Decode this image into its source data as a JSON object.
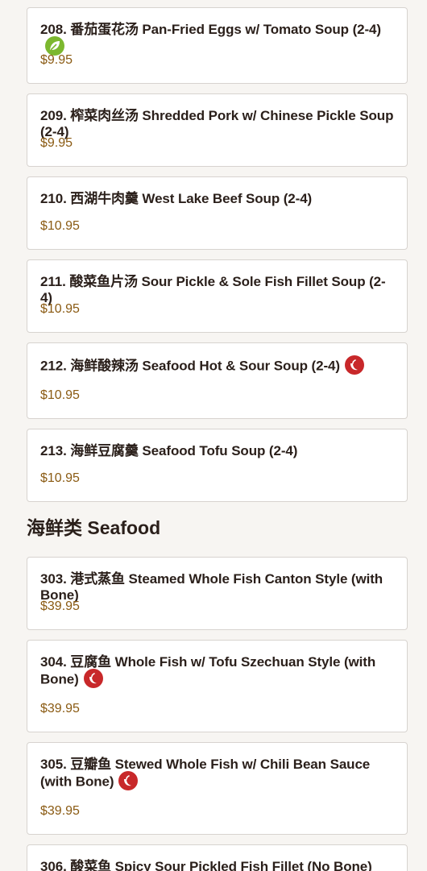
{
  "soups": [
    {
      "name": "208. 番茄蛋花汤 Pan-Fried Eggs w/ Tomato Soup (2-4)",
      "price": "$9.95",
      "badge": "leaf-icon"
    },
    {
      "name": "209. 榨菜肉丝汤 Shredded Pork w/ Chinese Pickle Soup (2-4)",
      "price": "$9.95",
      "badge": ""
    },
    {
      "name": "210. 西湖牛肉羹 West Lake Beef Soup (2-4)",
      "price": "$10.95",
      "badge": ""
    },
    {
      "name": "211. 酸菜鱼片汤 Sour Pickle & Sole Fish Fillet Soup (2-4)",
      "price": "$10.95",
      "badge": ""
    },
    {
      "name": "212. 海鲜酸辣汤 Seafood Hot & Sour Soup (2-4)",
      "price": "$10.95",
      "badge": "chili-icon"
    },
    {
      "name": "213. 海鲜豆腐羹 Seafood Tofu Soup (2-4)",
      "price": "$10.95",
      "badge": ""
    }
  ],
  "section": {
    "title": "海鲜类 Seafood"
  },
  "seafood": [
    {
      "name": "303. 港式蒸鱼 Steamed Whole Fish Canton Style (with Bone)",
      "price": "$39.95",
      "badge": ""
    },
    {
      "name": "304. 豆腐鱼 Whole Fish w/ Tofu Szechuan Style (with Bone)",
      "price": "$39.95",
      "badge": "chili-icon"
    },
    {
      "name": "305. 豆瓣鱼 Stewed Whole Fish w/ Chili Bean Sauce (with Bone)",
      "price": "$39.95",
      "badge": "chili-icon"
    },
    {
      "name": "306. 酸菜鱼 Spicy Sour Pickled Fish Fillet (No Bone)",
      "price": "",
      "badge": ""
    }
  ],
  "colors": {
    "leaf": "#7cb82f",
    "chili": "#c8282a",
    "price": "#8a5a12"
  }
}
